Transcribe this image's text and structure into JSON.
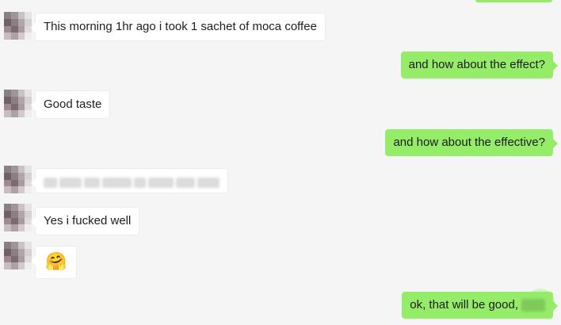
{
  "colors": {
    "background": "#f5f5f5",
    "incoming_bubble": "#ffffff",
    "outgoing_bubble": "#95ec69"
  },
  "messages": [
    {
      "direction": "in",
      "text": "This morning 1hr ago i took 1 sachet of moca coffee"
    },
    {
      "direction": "out",
      "text": "and how about the effect?"
    },
    {
      "direction": "in",
      "text": "Good taste"
    },
    {
      "direction": "out",
      "text": "and how about the effective?"
    },
    {
      "direction": "in",
      "text": ""
    },
    {
      "direction": "in",
      "text": "Yes i fucked well"
    },
    {
      "direction": "in",
      "icon": "hugging-face-emoji",
      "text": "🤗"
    },
    {
      "direction": "out",
      "text": "ok, that will be good,"
    }
  ]
}
